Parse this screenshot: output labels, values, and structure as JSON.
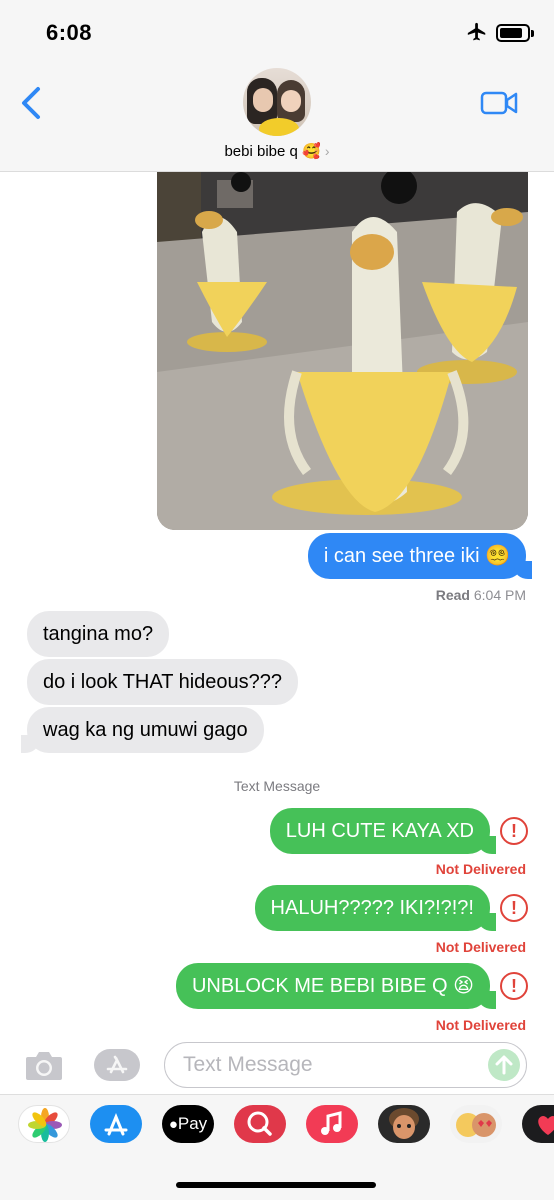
{
  "status_bar": {
    "time": "6:08"
  },
  "header": {
    "contact_name": "bebi bibe q 🥰",
    "chevron": "›"
  },
  "messages": {
    "blue_1": "i can see three iki 😵‍💫",
    "read_label": "Read",
    "read_time": "6:04 PM",
    "grey_1": "tangina mo?",
    "grey_2": "do i look THAT hideous???",
    "grey_3": "wag ka ng umuwi gago",
    "service_label": "Text Message",
    "green_1": "LUH CUTE KAYA XD",
    "green_2": "HALUH????? IKI?!?!?!",
    "green_3": "UNBLOCK ME BEBI BIBE Q 😫",
    "error_glyph": "!",
    "not_delivered": "Not Delivered"
  },
  "input": {
    "placeholder": "Text Message"
  },
  "app_drawer": {
    "apps": [
      "photos-icon",
      "app-store-icon",
      "apple-pay-icon",
      "search-images-icon",
      "music-icon",
      "memoji-icon",
      "memoji-stickers-icon",
      "digital-touch-icon"
    ],
    "apple_pay_label": "Pay"
  },
  "colors": {
    "imessage_blue": "#2f88f5",
    "sms_green": "#46c158",
    "error_red": "#e0433a",
    "incoming_grey": "#e9e9eb"
  }
}
